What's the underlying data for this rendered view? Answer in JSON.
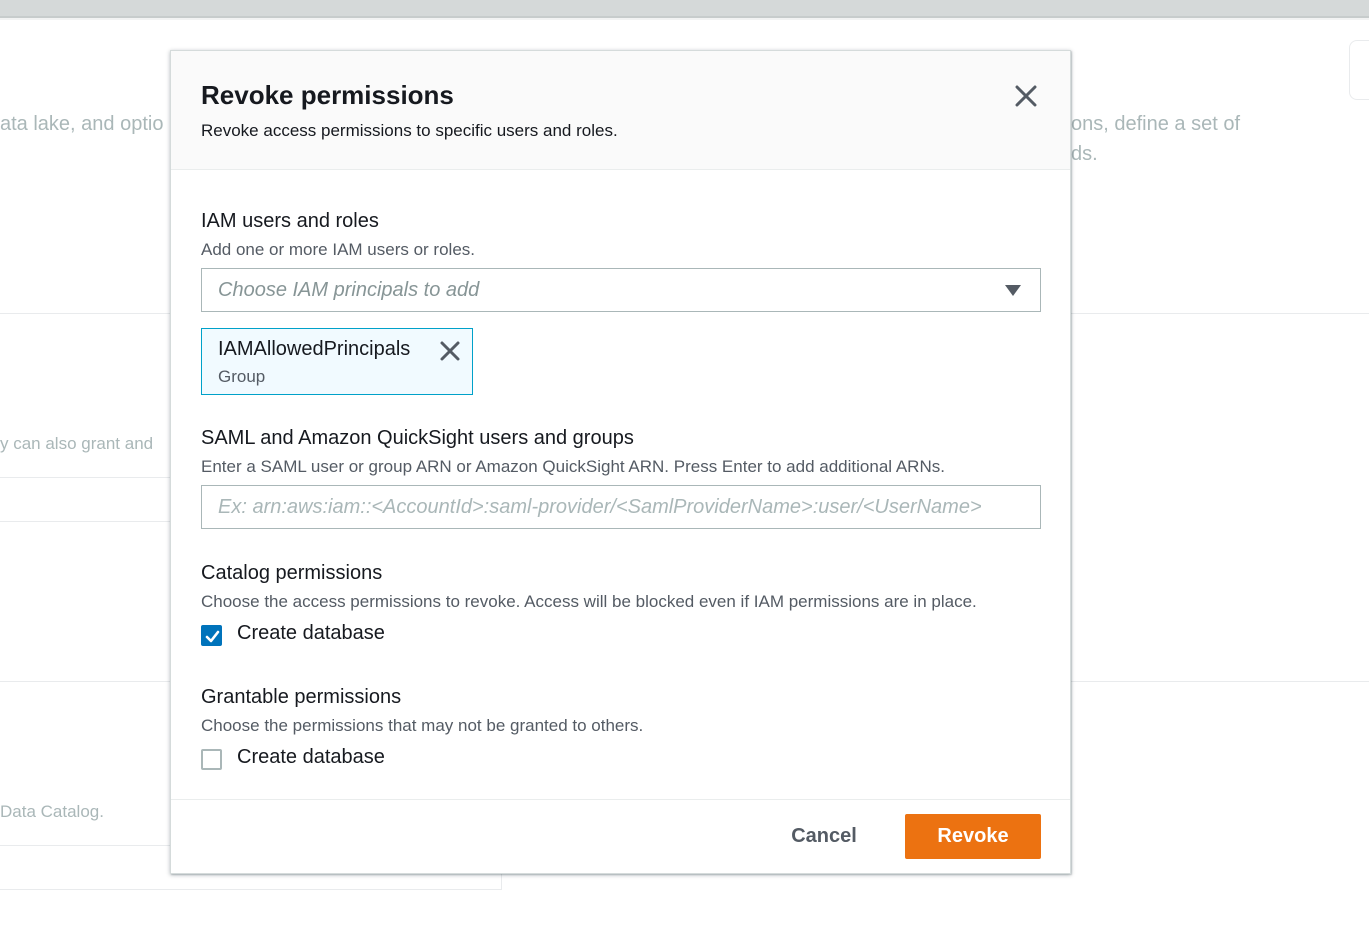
{
  "background": {
    "text_1": "ata lake, and optio",
    "text_2": "ons, define a set of",
    "text_3": "ds.",
    "text_4": "y can also grant and",
    "text_5": "Data Catalog."
  },
  "modal": {
    "title": "Revoke permissions",
    "subtitle": "Revoke access permissions to specific users and roles.",
    "close_icon": "close-icon",
    "iam": {
      "label": "IAM users and roles",
      "description": "Add one or more IAM users or roles.",
      "placeholder": "Choose IAM principals to add",
      "dropdown_icon": "caret-down-icon",
      "tokens": [
        {
          "name": "IAMAllowedPrincipals",
          "type": "Group"
        }
      ]
    },
    "saml": {
      "label": "SAML and Amazon QuickSight users and groups",
      "description": "Enter a SAML user or group ARN or Amazon QuickSight ARN. Press Enter to add additional ARNs.",
      "placeholder": "Ex: arn:aws:iam::<AccountId>:saml-provider/<SamlProviderName>:user/<UserName>",
      "value": ""
    },
    "catalog_permissions": {
      "label": "Catalog permissions",
      "description": "Choose the access permissions to revoke. Access will be blocked even if IAM permissions are in place.",
      "options": [
        {
          "label": "Create database",
          "checked": true
        }
      ]
    },
    "grantable_permissions": {
      "label": "Grantable permissions",
      "description": "Choose the permissions that may not be granted to others.",
      "options": [
        {
          "label": "Create database",
          "checked": false
        }
      ]
    },
    "footer": {
      "cancel_label": "Cancel",
      "revoke_label": "Revoke"
    }
  },
  "colors": {
    "primary_button": "#ec7211",
    "checkbox_checked": "#0073bb",
    "token_border": "#00a1c9",
    "token_background": "#f1faff"
  }
}
